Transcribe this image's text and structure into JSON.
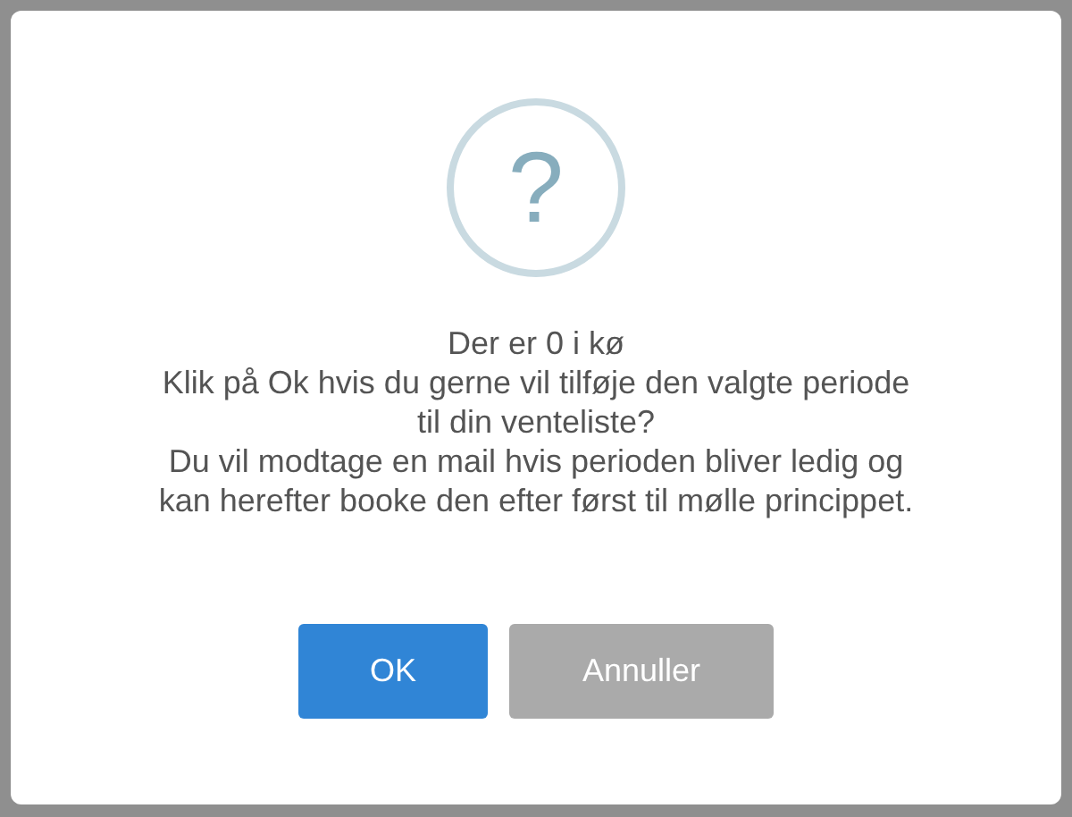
{
  "dialog": {
    "icon": "?",
    "message": [
      "Der er 0 i kø",
      "Klik på Ok hvis du gerne vil tilføje den valgte periode til din venteliste?",
      "Du vil modtage en mail hvis perioden bliver ledig og kan herefter booke den efter først til mølle princippet."
    ],
    "buttons": [
      {
        "label": "OK",
        "kind": "confirm"
      },
      {
        "label": "Annuller",
        "kind": "cancel"
      }
    ]
  }
}
